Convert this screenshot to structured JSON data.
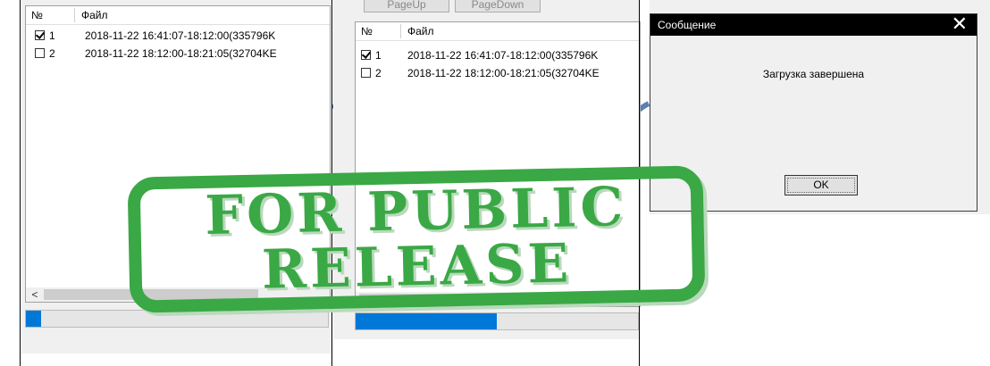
{
  "windows": [
    {
      "header": {
        "col_num": "№",
        "col_file": "Файл"
      },
      "rows": [
        {
          "num": "1",
          "file": "2018-11-22 16:41:07-18:12:00(335796K",
          "checked": true
        },
        {
          "num": "2",
          "file": "2018-11-22 18:12:00-18:21:05(32704KE",
          "checked": false
        }
      ],
      "scroll_left_arrow": "<",
      "progress": 0.05,
      "progress_color": "#0078d7"
    },
    {
      "top_buttons": [
        "PageUp",
        "PageDown"
      ],
      "header": {
        "col_num": "№",
        "col_file": "Файл"
      },
      "rows": [
        {
          "num": "1",
          "file": "2018-11-22 16:41:07-18:12:00(335796K",
          "checked": true
        },
        {
          "num": "2",
          "file": "2018-11-22 18:12:00-18:21:05(32704KE",
          "checked": false
        }
      ],
      "scroll_right_arrow": ">",
      "progress": 0.5,
      "progress_color": "#0078d7"
    }
  ],
  "dialog": {
    "title": "Сообщение",
    "close_icon": "close-icon",
    "message": "Загрузка завершена",
    "ok_label": "OK"
  },
  "stamp": {
    "line1": "FOR PUBLIC",
    "line2": "RELEASE",
    "color": "#3aa845"
  }
}
